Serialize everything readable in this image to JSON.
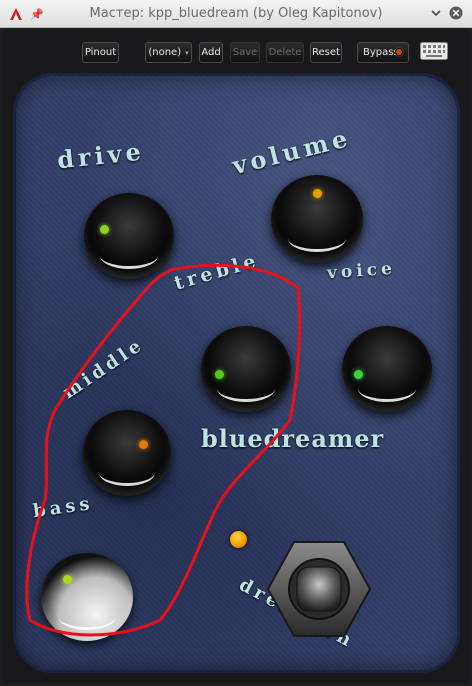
{
  "window": {
    "title": "Мастер: kpp_bluedream (by Oleg Kapitonov)",
    "app_icon": "ardour-triangle-icon",
    "pin_icon": "pin-icon",
    "minimize_icon": "chevron-down-icon",
    "close_icon": "close-icon"
  },
  "toolbar": {
    "pinout_label": "Pinout",
    "preset_value": "(none)",
    "add_label": "Add",
    "save_label": "Save",
    "delete_label": "Delete",
    "reset_label": "Reset",
    "bypass_label": "Bypass",
    "keyboard_icon": "keyboard-icon",
    "disabled": [
      "Save",
      "Delete"
    ]
  },
  "pedal": {
    "brand_text": "bluedreamer",
    "knobs": [
      {
        "label": "drive",
        "led": "#8ed12a"
      },
      {
        "label": "volume",
        "led": "#e0a000"
      },
      {
        "label": "treble",
        "led": "#52c81e"
      },
      {
        "label": "voice",
        "led": "#3ed040"
      },
      {
        "label": "middle",
        "led": "#e07a00"
      },
      {
        "label": "bass",
        "led": "#b0d820"
      }
    ],
    "footswitch_label": "dream on",
    "status_led_color": "#f0a000"
  },
  "colors": {
    "pedal_blue": "#33406a",
    "label_cyan": "#bfe3e4",
    "annotation_red": "#e8101a"
  }
}
